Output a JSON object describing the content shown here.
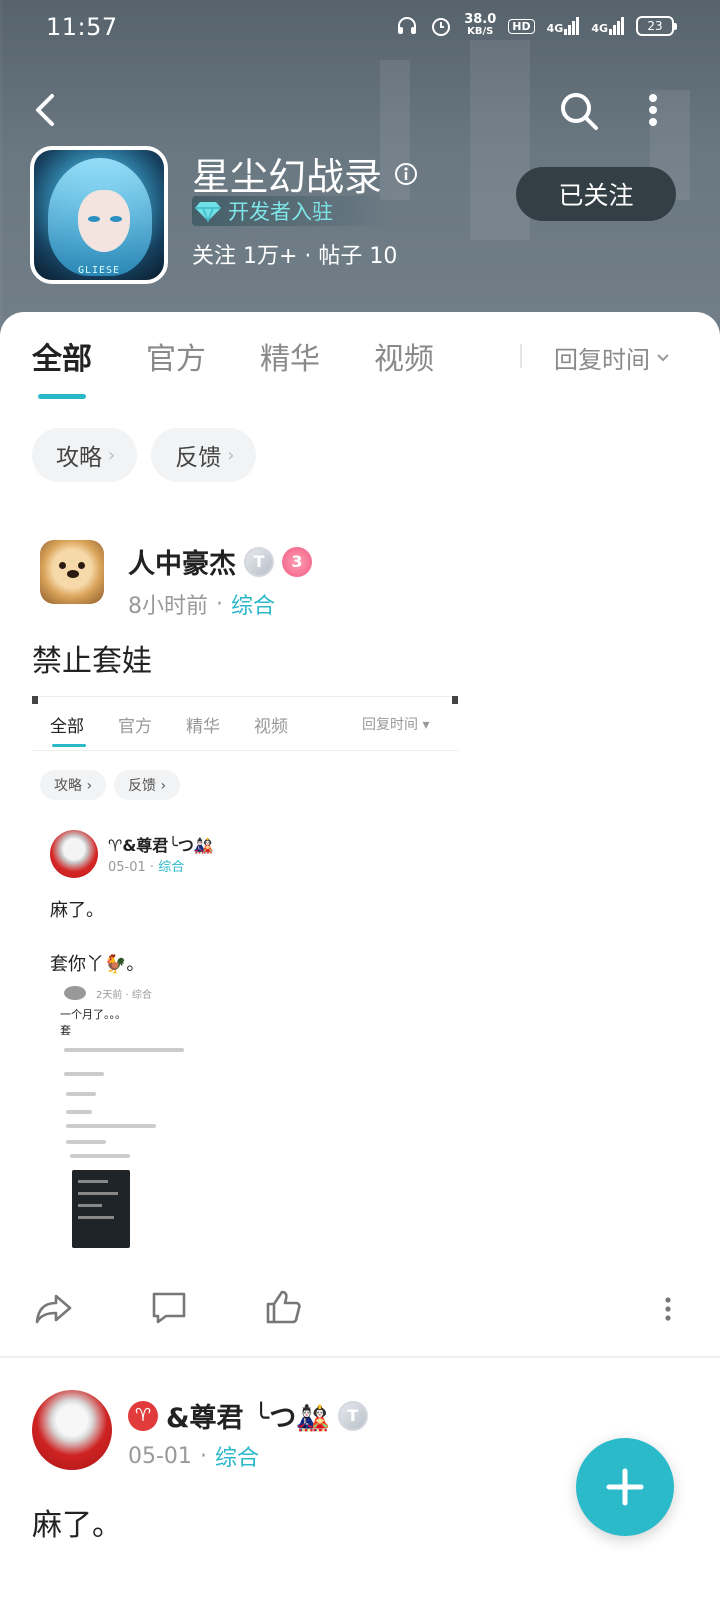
{
  "status_bar": {
    "time": "11:57",
    "speed_value": "38.0",
    "speed_unit": "KB/S",
    "hd_label": "HD",
    "network_1": "4G",
    "network_2": "4G",
    "battery": "23"
  },
  "forum": {
    "title": "星尘幻战录",
    "developer_badge": "开发者入驻",
    "stats": "关注 1万+ · 帖子 10",
    "follow_button": "已关注",
    "icon_brand": "GLIESE"
  },
  "tabs": [
    "全部",
    "官方",
    "精华",
    "视频"
  ],
  "sort": {
    "label": "回复时间"
  },
  "chips": [
    "攻略",
    "反馈"
  ],
  "post1": {
    "author": "人中豪杰",
    "level_badge": "T",
    "medal": "3",
    "time": "8小时前",
    "category": "综合",
    "title": "禁止套娃"
  },
  "screenshot": {
    "tabs": [
      "全部",
      "官方",
      "精华",
      "视频"
    ],
    "sort": "回复时间 ▾",
    "chips": [
      "攻略 ›",
      "反馈 ›"
    ],
    "author": "♈&尊君╰つ🎎",
    "time": "05-01",
    "category": "综合",
    "line1": "麻了。",
    "line2": "套你丫🐓。",
    "nested_meta": "2天前 · 综合",
    "nested_line1": "一个月了。。。",
    "nested_line2": "套"
  },
  "post2": {
    "aries_symbol": "♈",
    "author": "&尊君 ╰つ🎎",
    "level_badge": "T",
    "time": "05-01",
    "category": "综合",
    "body": "麻了。"
  },
  "colors": {
    "accent": "#2bb8c8",
    "header_bg": "#6a7882",
    "follow_bg": "#333e45"
  }
}
